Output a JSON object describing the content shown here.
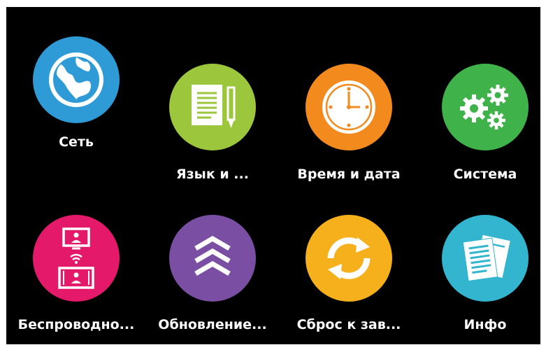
{
  "menu": {
    "items": [
      {
        "label": "Сеть",
        "icon": "globe-icon",
        "color": "#2e9bd6"
      },
      {
        "label": "Язык и ...",
        "icon": "notepad-icon",
        "color": "#9cc63b"
      },
      {
        "label": "Время и дата",
        "icon": "clock-icon",
        "color": "#f28a1e"
      },
      {
        "label": "Система",
        "icon": "gears-icon",
        "color": "#3fb34a"
      },
      {
        "label": "Беспроводно...",
        "icon": "wireless-display-icon",
        "color": "#e5196a"
      },
      {
        "label": "Обновление...",
        "icon": "update-chevrons-icon",
        "color": "#7a4fa3"
      },
      {
        "label": "Сброс к зав...",
        "icon": "reset-arrows-icon",
        "color": "#f5b01c"
      },
      {
        "label": "Инфо",
        "icon": "documents-icon",
        "color": "#33b4cf"
      }
    ]
  }
}
